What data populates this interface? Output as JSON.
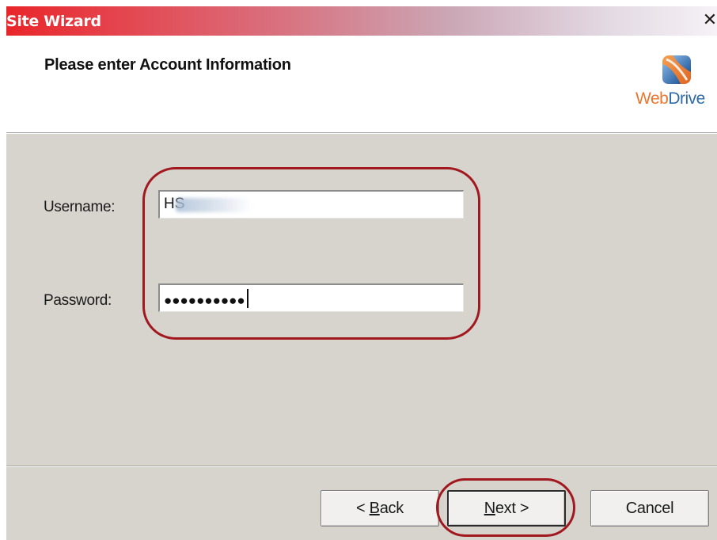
{
  "window": {
    "title": "Site Wizard",
    "close_glyph": "✕"
  },
  "header": {
    "title": "Please enter Account Information",
    "logo": {
      "icon": "webdrive-logo-icon",
      "text_web": "Web",
      "text_drive": "Drive"
    }
  },
  "form": {
    "username": {
      "label": "Username:",
      "value": "HS"
    },
    "password": {
      "label": "Password:",
      "value": "●●●●●●●●●●"
    }
  },
  "buttons": {
    "back": {
      "prefix": "< ",
      "mnemonic": "B",
      "rest": "ack"
    },
    "next": {
      "mnemonic": "N",
      "rest": "ext >"
    },
    "cancel": {
      "label": "Cancel"
    }
  },
  "colors": {
    "title_start": "#e8262a",
    "annotation": "#a2181f",
    "dialog_bg": "#d7d3cd",
    "logo_orange": "#e8772e",
    "logo_blue": "#2f6ba8"
  }
}
